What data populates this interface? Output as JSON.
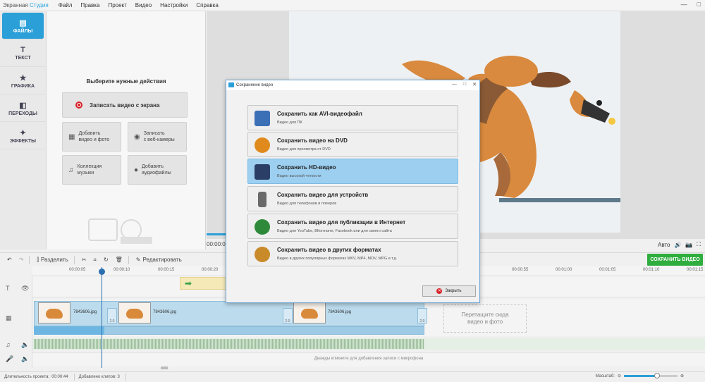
{
  "app": {
    "title_main": "Экранная",
    "title_accent": "Студия"
  },
  "menu": [
    "Файл",
    "Правка",
    "Проект",
    "Видео",
    "Настройки",
    "Справка"
  ],
  "window_buttons": [
    "—",
    "□"
  ],
  "rail": [
    {
      "label": "ФАЙЛЫ",
      "icon": "file-icon",
      "glyph": "▤"
    },
    {
      "label": "ТЕКСТ",
      "icon": "text-icon",
      "glyph": "T"
    },
    {
      "label": "ГРАФИКА",
      "icon": "star-icon",
      "glyph": "★"
    },
    {
      "label": "ПЕРЕХОДЫ",
      "icon": "transitions-icon",
      "glyph": "◧"
    },
    {
      "label": "ЭФФЕКТЫ",
      "icon": "wand-icon",
      "glyph": "✦"
    }
  ],
  "panel": {
    "title": "Выберите нужные действия",
    "record_label": "Записать видео с экрана",
    "buttons": [
      {
        "name": "add-video-photo-button",
        "label": "Добавить\nвидео и фото",
        "glyph": "▦"
      },
      {
        "name": "webcam-record-button",
        "label": "Записать\nс веб-камеры",
        "glyph": "◉"
      },
      {
        "name": "music-collection-button",
        "label": "Коллекция\nмузыки",
        "glyph": "♫"
      },
      {
        "name": "add-audio-button",
        "label": "Добавить\nаудиофайлы",
        "glyph": "🎤"
      }
    ]
  },
  "preview": {
    "timecode": "00:00:0",
    "auto_label": "Авто"
  },
  "toolbar": {
    "split_label": "Разделить",
    "edit_label": "Редактировать",
    "save_video_label": "СОХРАНИТЬ ВИДЕО"
  },
  "ruler": {
    "ticks": [
      "00:00:05",
      "00:00:10",
      "00:00:15",
      "00:00:20",
      "00:00:55",
      "00:01:00",
      "00:01:05",
      "00:01:10",
      "00:01:15"
    ]
  },
  "timeline": {
    "clip_names": [
      "7843606.jpg",
      "7843606.jpg",
      "7843606.jpg"
    ],
    "transition_label": "2.0",
    "drop_zone": "Перетащите сюда\nвидео и фото",
    "mic_hint": "Дважды кликните для добавления записи с микрофона"
  },
  "statusbar": {
    "duration_label": "Длительность проекта:",
    "duration_value": "00:00:44",
    "clips_label": "Добавлено клипов: 3",
    "zoom_label": "Масштаб:",
    "zoom_level": 0.62
  },
  "modal": {
    "title": "Сохранение видео",
    "options": [
      {
        "title": "Сохранить как AVI-видеофайл",
        "sub": "Видео для ПК",
        "icon": "pc-icon",
        "color": "#3b6fb6"
      },
      {
        "title": "Сохранить видео на DVD",
        "sub": "Видео для просмотра от DVD",
        "icon": "dvd-icon",
        "color": "#e08a1e"
      },
      {
        "title": "Сохранить HD-видео",
        "sub": "Видео высокой четкости",
        "icon": "monitor-icon",
        "color": "#2b3f66"
      },
      {
        "title": "Сохранить видео для устройств",
        "sub": "Видео для телефонов и плееров",
        "icon": "phone-icon",
        "color": "#6a6a6a"
      },
      {
        "title": "Сохранить видео для публикации в Интернет",
        "sub": "Видео для YouTube, ВКонтакте, Facebook или для своего сайта",
        "icon": "globe-icon",
        "color": "#2e8a3a"
      },
      {
        "title": "Сохранить видео в других форматах",
        "sub": "Видео в других популярных форматах MKV, MP4, MOV, MPG и т.д.",
        "icon": "film-reel-icon",
        "color": "#c98a2a"
      }
    ],
    "selected_index": 2,
    "close_label": "Закрыть"
  }
}
